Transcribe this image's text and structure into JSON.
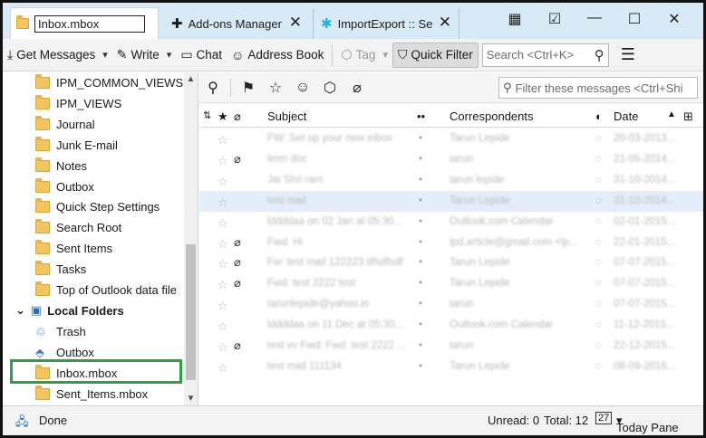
{
  "tabs": [
    {
      "label": "Inbox.mbox",
      "icon": "folder-icon"
    },
    {
      "label": "Add-ons Manager",
      "icon": "puzzle-icon"
    },
    {
      "label": "ImportExport :: Se",
      "icon": "addon-icon"
    }
  ],
  "window_controls": {
    "calendar": "calendar-icon",
    "tasks": "tasks-icon",
    "minimize": "—",
    "maximize": "☐",
    "close": "✕"
  },
  "toolbar": {
    "get_messages": "Get Messages",
    "write": "Write",
    "chat": "Chat",
    "address_book": "Address Book",
    "tag": "Tag",
    "quick_filter": "Quick Filter",
    "search_placeholder": "Search <Ctrl+K>"
  },
  "folders": {
    "items": [
      {
        "label": "IPM_COMMON_VIEWS"
      },
      {
        "label": "IPM_VIEWS"
      },
      {
        "label": "Journal"
      },
      {
        "label": "Junk E-mail"
      },
      {
        "label": "Notes"
      },
      {
        "label": "Outbox"
      },
      {
        "label": "Quick Step Settings"
      },
      {
        "label": "Search Root"
      },
      {
        "label": "Sent Items"
      },
      {
        "label": "Tasks"
      },
      {
        "label": "Top of Outlook data file"
      }
    ],
    "local_folders": "Local Folders",
    "local_items": [
      {
        "label": "Trash"
      },
      {
        "label": "Outbox"
      },
      {
        "label": "Inbox.mbox"
      },
      {
        "label": "Sent_Items.mbox"
      }
    ]
  },
  "quick_filter_bar": {
    "filter_placeholder": "Filter these messages <Ctrl+Shi"
  },
  "columns": {
    "subject": "Subject",
    "correspondents": "Correspondents",
    "date": "Date"
  },
  "messages": [
    {
      "subject": "FW: Set up your new inbox",
      "correspondent": "Tarun Lepide",
      "date": "20-03-2013...",
      "attach": false
    },
    {
      "subject": "lerm doc",
      "correspondent": "tarun",
      "date": "21-05-2014...",
      "attach": true
    },
    {
      "subject": "Jai Shri ram",
      "correspondent": "tarun lepide",
      "date": "31-10-2014...",
      "attach": false
    },
    {
      "subject": "test  mail",
      "correspondent": "Tarun Lepide",
      "date": "31-10-2014...",
      "attach": false
    },
    {
      "subject": "lddddaa on 02 Jan at 05:30...",
      "correspondent": "Outlook.com Calendar",
      "date": "02-01-2015...",
      "attach": false
    },
    {
      "subject": "Fwd: Hi",
      "correspondent": "lpd.article@gmail.com <lp...",
      "date": "22-01-2015...",
      "attach": true
    },
    {
      "subject": "Fw: test mail 122223 dfsdfsdf",
      "correspondent": "Tarun Lepide",
      "date": "07-07-2015...",
      "attach": true
    },
    {
      "subject": "Fwd: test 2222 test",
      "correspondent": "Tarun Lepide",
      "date": "07-07-2015...",
      "attach": true
    },
    {
      "subject": "tarunlepide@yahoo.in",
      "correspondent": "tarun",
      "date": "07-07-2015...",
      "attach": false
    },
    {
      "subject": "lddddaa on 11 Dec at 05:30...",
      "correspondent": "Outlook.com Calendar",
      "date": "11-12-2015...",
      "attach": false
    },
    {
      "subject": "test vv Fwd: Fwd: test 2222 ...",
      "correspondent": "tarun",
      "date": "22-12-2015...",
      "attach": true
    },
    {
      "subject": "test mail 111134",
      "correspondent": "Tarun Lepide",
      "date": "08-09-2016...",
      "attach": false
    }
  ],
  "status": {
    "done": "Done",
    "unread": "Unread: 0",
    "total": "Total: 12",
    "today_pane": "Today Pane",
    "today_badge": "27"
  },
  "colors": {
    "titlebar": "#d9eaf7",
    "selected_row": "#e4eefa",
    "highlight_box": "#2ea043",
    "folder": "#f4c55a"
  }
}
